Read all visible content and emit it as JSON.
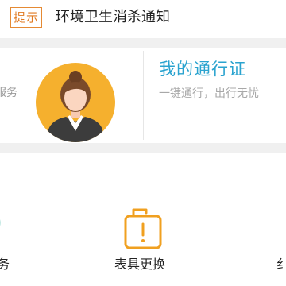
{
  "notice": {
    "tag": "提示",
    "text": "环境卫生消杀通知"
  },
  "card": {
    "left_partial_label": "服务",
    "pass_title": "我的通行证",
    "pass_subtitle": "一键通行，出行无忧"
  },
  "grid": {
    "left_partial_label": "务",
    "center_label": "表具更换",
    "right_partial_label": "纟"
  },
  "colors": {
    "accent_orange": "#e58a34",
    "pass_blue": "#2aa3cf",
    "avatar_bg": "#f5b02e"
  },
  "icons": {
    "avatar": "user-avatar-icon",
    "meter_replace": "meter-replace-icon"
  }
}
